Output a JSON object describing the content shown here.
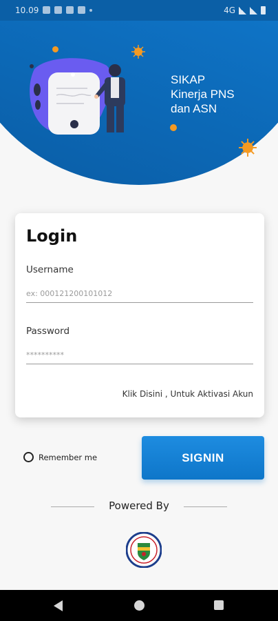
{
  "status_bar": {
    "time": "10.09",
    "network": "4G",
    "icons": [
      "gallery-icon",
      "notification-icon",
      "instagram-icon",
      "mail-icon",
      "dot-icon",
      "signal-icon",
      "battery-icon"
    ]
  },
  "header": {
    "app_title_line1": "SIKAP",
    "app_title_line2": "Kinerja PNS",
    "app_title_line3": "dan ASN"
  },
  "login": {
    "title": "Login",
    "username_label": "Username",
    "username_placeholder": "ex: 000121200101012",
    "password_label": "Password",
    "password_value": "**********",
    "activation_link": "Klik Disini , Untuk Aktivasi Akun"
  },
  "remember_label": "Remember me",
  "signin_label": "SIGNIN",
  "powered_by": "Powered By",
  "colors": {
    "primary": "#0e76c9",
    "header_dark": "#0a5ca4",
    "accent_orange": "#f59a23",
    "background": "#f7f7f7"
  }
}
